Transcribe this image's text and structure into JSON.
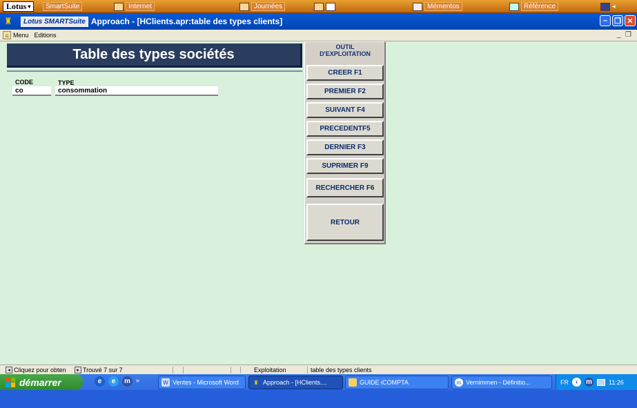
{
  "suitebar": {
    "logo": "Lotus",
    "items": [
      {
        "label": "SmartSuite"
      },
      {
        "label": "Internet"
      },
      {
        "label": "Journées"
      },
      {
        "label": "Mémentos"
      },
      {
        "label": "Référence"
      }
    ]
  },
  "titlebar": {
    "suite_brand": "Lotus SMARTSuite",
    "title": "Approach - [HClients.apr:table des types clients]"
  },
  "menubar": {
    "items": [
      "Menu",
      "Editions"
    ]
  },
  "form": {
    "header": "Table des types sociétés",
    "code_label": "CODE",
    "type_label": "TYPE",
    "code_value": "co",
    "type_value": "consommation"
  },
  "panel": {
    "title_line1": "OUTIL",
    "title_line2": "D'EXPLOITATION",
    "buttons": [
      "CREER F1",
      "PREMIER F2",
      "SUIVANT F4",
      "PRECEDENTF5",
      "DERNIER F3",
      "SUPRIMER F9",
      "RECHERCHER F6",
      "RETOUR"
    ]
  },
  "statusbar": {
    "hint": "Cliquez pour obten",
    "found": "Trouvé 7 sur 7",
    "mode": "Exploitation",
    "view": "table des types clients"
  },
  "taskbar": {
    "start_label": "démarrer",
    "windows": [
      {
        "label": "Ventes - Microsoft Word",
        "active": false
      },
      {
        "label": "Approach - [HClients....",
        "active": true
      },
      {
        "label": "GUIDE iCOMPTA",
        "active": false
      },
      {
        "label": "Vernimmen - Définitio...",
        "active": false
      }
    ],
    "tray_lang": "FR",
    "clock": "11:26"
  }
}
